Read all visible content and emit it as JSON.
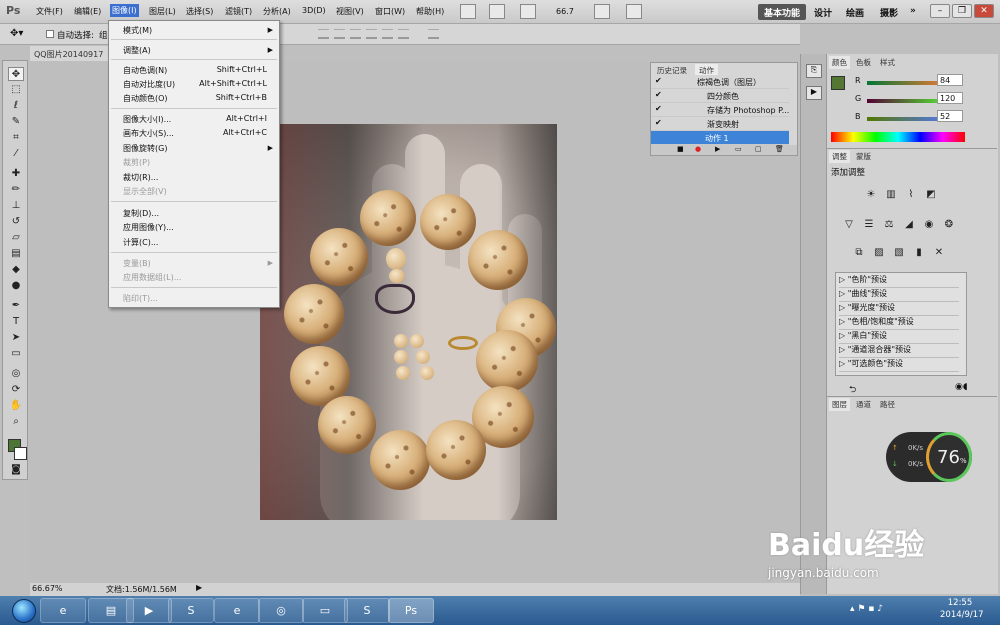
{
  "app": {
    "logo": "Ps"
  },
  "menubar": {
    "items": [
      "文件(F)",
      "编辑(E)",
      "图像(I)",
      "图层(L)",
      "选择(S)",
      "滤镜(T)",
      "分析(A)",
      "3D(D)",
      "视图(V)",
      "窗口(W)",
      "帮助(H)"
    ],
    "zoom": "66.7",
    "workspaces": [
      "基本功能",
      "设计",
      "绘画",
      "摄影",
      "»"
    ]
  },
  "options": {
    "autoselect_label": "自动选择:",
    "autoselect_value": "组"
  },
  "document": {
    "tab": "QQ图片20140917"
  },
  "image_menu": {
    "items": [
      {
        "label": "模式(M)",
        "shortcut": "",
        "submenu": true,
        "disabled": false
      },
      {
        "label": "调整(A)",
        "shortcut": "",
        "submenu": true,
        "disabled": false
      },
      {
        "label": "自动色调(N)",
        "shortcut": "Shift+Ctrl+L",
        "submenu": false,
        "disabled": false
      },
      {
        "label": "自动对比度(U)",
        "shortcut": "Alt+Shift+Ctrl+L",
        "submenu": false,
        "disabled": false
      },
      {
        "label": "自动颜色(O)",
        "shortcut": "Shift+Ctrl+B",
        "submenu": false,
        "disabled": false
      },
      {
        "label": "图像大小(I)...",
        "shortcut": "Alt+Ctrl+I",
        "submenu": false,
        "disabled": false
      },
      {
        "label": "画布大小(S)...",
        "shortcut": "Alt+Ctrl+C",
        "submenu": false,
        "disabled": false
      },
      {
        "label": "图像旋转(G)",
        "shortcut": "",
        "submenu": true,
        "disabled": false
      },
      {
        "label": "裁剪(P)",
        "shortcut": "",
        "submenu": false,
        "disabled": true
      },
      {
        "label": "裁切(R)...",
        "shortcut": "",
        "submenu": false,
        "disabled": false
      },
      {
        "label": "显示全部(V)",
        "shortcut": "",
        "submenu": false,
        "disabled": true
      },
      {
        "label": "复制(D)...",
        "shortcut": "",
        "submenu": false,
        "disabled": false
      },
      {
        "label": "应用图像(Y)...",
        "shortcut": "",
        "submenu": false,
        "disabled": false
      },
      {
        "label": "计算(C)...",
        "shortcut": "",
        "submenu": false,
        "disabled": false
      },
      {
        "label": "变量(B)",
        "shortcut": "",
        "submenu": true,
        "disabled": true
      },
      {
        "label": "应用数据组(L)...",
        "shortcut": "",
        "submenu": false,
        "disabled": true
      },
      {
        "label": "陷印(T)...",
        "shortcut": "",
        "submenu": false,
        "disabled": true
      }
    ]
  },
  "history_panel": {
    "tabs": [
      "历史记录",
      "动作"
    ],
    "actions": [
      {
        "label": "棕褐色调（图层）",
        "checked": true,
        "selected": false
      },
      {
        "label": "四分颜色",
        "checked": true,
        "selected": false
      },
      {
        "label": "存储为 Photoshop P...",
        "checked": true,
        "selected": false
      },
      {
        "label": "渐变映射",
        "checked": true,
        "selected": false
      },
      {
        "label": "动作 1",
        "checked": false,
        "selected": true
      }
    ]
  },
  "color_panel": {
    "tabs": [
      "颜色",
      "色板",
      "样式"
    ],
    "r": "84",
    "g": "120",
    "b": "52",
    "r_label": "R",
    "g_label": "G",
    "b_label": "B",
    "fg_hex": "#547834"
  },
  "adjust_panel": {
    "tabs": [
      "调整",
      "蒙版"
    ],
    "title": "添加调整",
    "presets": [
      "\"色阶\"预设",
      "\"曲线\"预设",
      "\"曝光度\"预设",
      "\"色相/饱和度\"预设",
      "\"黑白\"预设",
      "\"通道混合器\"预设",
      "\"可选颜色\"预设"
    ]
  },
  "layers_panel": {
    "tabs": [
      "图层",
      "通道",
      "路径"
    ]
  },
  "status": {
    "zoom": "66.67%",
    "doc": "文档:1.56M/1.56M"
  },
  "speed_widget": {
    "percent": "76",
    "pct_sign": "%",
    "up": "0K/s",
    "down": "0K/s"
  },
  "taskbar": {
    "time": "12:55",
    "date": "2014/9/17"
  },
  "watermark": {
    "logo": "Baidu经验",
    "url": "jingyan.baidu.com"
  }
}
